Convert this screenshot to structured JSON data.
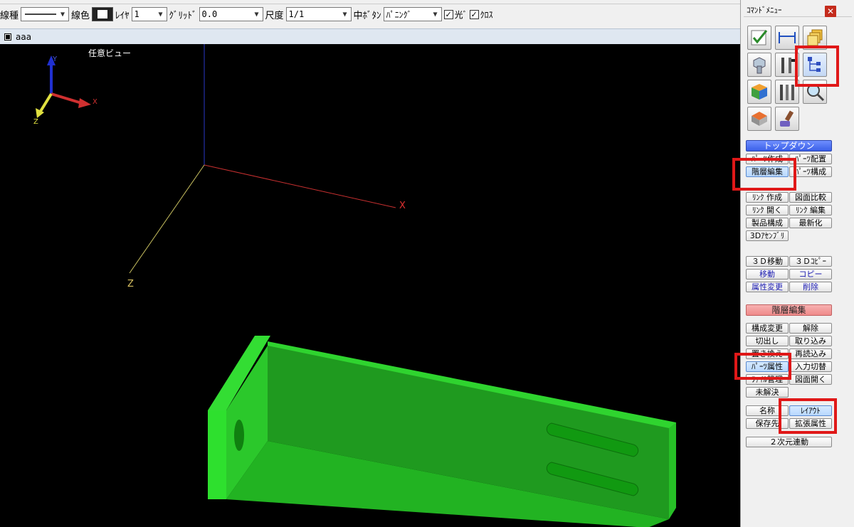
{
  "toolbar": {
    "line_type_label": "線種",
    "line_color_label": "線色",
    "layer_label": "ﾚｲﾔ",
    "layer_value": "1",
    "grid_label": "ｸﾞﾘｯﾄﾞ",
    "grid_value": "0.0",
    "scale_label": "尺度",
    "scale_value": "1/1",
    "middle_button_label": "中ﾎﾞﾀﾝ",
    "middle_button_value": "ﾊﾟﾆﾝｸﾞ",
    "light_label": "光ﾞ",
    "cross_label": "ｸﾛｽ"
  },
  "document": {
    "tab_title": "aaa"
  },
  "viewport": {
    "view_label": "任意ビュー",
    "gizmo": {
      "x": "X",
      "y": "Y",
      "z": "Z"
    },
    "axis_x": "X",
    "axis_z": "Z",
    "colors": {
      "background": "#000000",
      "part_green": "#22c422",
      "x_axis": "#d03030",
      "y_axis": "#2030d0",
      "z_axis": "#e0e040"
    }
  },
  "panel": {
    "title": "ｺﾏﾝﾄﾞﾒﾆｭｰ",
    "close_icon": "close-icon",
    "icon_buttons": [
      "check-draw-icon",
      "dimension-icon",
      "layers-icon",
      "bolt-icon",
      "tools-icon",
      "tree-hierarchy-icon",
      "cube-icon",
      "parts-tools-icon",
      "magnifier-icon",
      "paint-bucket-icon",
      "paint-roller-icon"
    ],
    "topdown_header": "トップダウン",
    "topdown_items": [
      "ﾊﾟｰﾂ作成",
      "ﾊﾟｰﾂ配置",
      "階層編集",
      "ﾊﾟｰﾂ構成"
    ],
    "link_items": [
      "ﾘﾝｸ 作成",
      "図面比較",
      "ﾘﾝｸ 開く",
      "ﾘﾝｸ 編集",
      "製品構成",
      "最新化",
      "3Dｱｾﾝﾌﾞﾘ"
    ],
    "move_items": [
      "３Ｄ移動",
      "３Ｄｺﾋﾟｰ",
      "移動",
      "コピー",
      "属性変更",
      "削除"
    ],
    "hierarchy_header": "階層編集",
    "hierarchy_items": [
      "構成変更",
      "解除",
      "切出し",
      "取り込み",
      "置き換え",
      "再読込み",
      "ﾊﾟｰﾂ属性",
      "入力切替",
      "ﾌｧｲﾙ管理",
      "図面開く",
      "未解決"
    ],
    "attr_items": [
      "名称",
      "ﾚｲｱｳﾄ",
      "保存先",
      "拡張属性"
    ],
    "link2d": "２次元連動",
    "accent_blue": "#3a5fe8",
    "accent_red": "#ef8a8a",
    "highlight": "#e01818"
  }
}
